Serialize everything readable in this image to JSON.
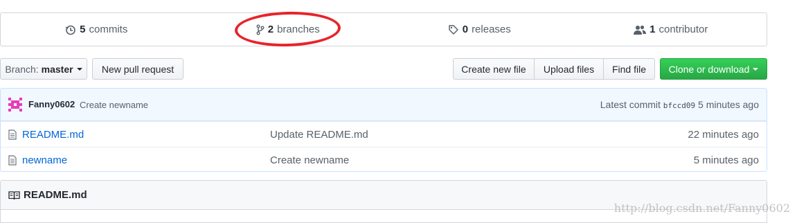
{
  "summary": {
    "commits": {
      "count": "5",
      "label": "commits",
      "icon": "history-icon"
    },
    "branches": {
      "count": "2",
      "label": "branches",
      "icon": "git-branch-icon"
    },
    "releases": {
      "count": "0",
      "label": "releases",
      "icon": "tag-icon"
    },
    "contributors": {
      "count": "1",
      "label": "contributor",
      "icon": "people-icon"
    }
  },
  "annotation": {
    "color": "#e8232a",
    "target": "branches"
  },
  "toolbar": {
    "branch_prefix": "Branch:",
    "branch_name": "master",
    "new_pull_request": "New pull request",
    "create_new_file": "Create new file",
    "upload_files": "Upload files",
    "find_file": "Find file",
    "clone_or_download": "Clone or download",
    "accent_green": "#28a745"
  },
  "latest_commit": {
    "author": "Fanny0602",
    "message": "Create newname",
    "prefix": "Latest commit",
    "sha": "bfccd09",
    "age": "5 minutes ago",
    "avatar_color": "#e63db8"
  },
  "files": [
    {
      "name": "README.md",
      "message": "Update README.md",
      "age": "22 minutes ago",
      "icon": "file-icon"
    },
    {
      "name": "newname",
      "message": "Create newname",
      "age": "5 minutes ago",
      "icon": "file-icon"
    }
  ],
  "readme": {
    "title": "README.md",
    "icon": "book-icon"
  },
  "watermark": "http://blog.csdn.net/Fanny0602"
}
